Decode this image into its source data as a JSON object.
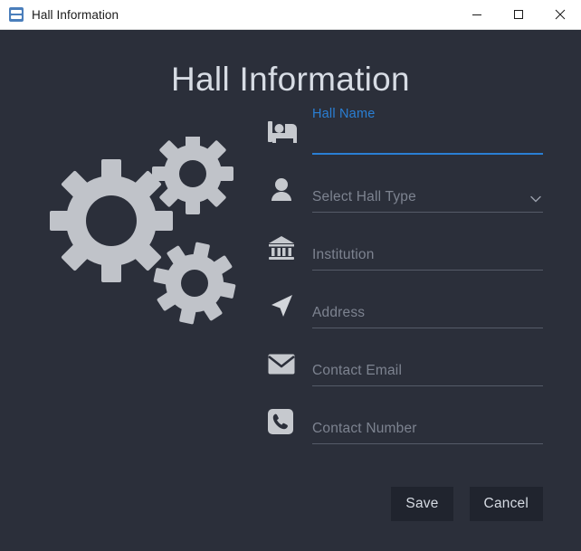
{
  "window": {
    "title": "Hall Information",
    "icon": "app-icon",
    "controls": {
      "minimize": "minimize-icon",
      "maximize": "maximize-icon",
      "close": "close-icon"
    },
    "colors": {
      "titlebar_bg": "#ffffff",
      "titlebar_text": "#1a1a1a",
      "body_bg": "#2b2f3a",
      "accent": "#2a7fd4",
      "placeholder": "#7d8390",
      "heading": "#d7dce4",
      "icon_gray": "#c6c9ce",
      "button_bg": "#20242e"
    }
  },
  "heading": "Hall Information",
  "illustration": {
    "name": "gears-illustration",
    "color": "#c0c3c9",
    "gear_count": 3
  },
  "form": {
    "fields": [
      {
        "name": "hall-name",
        "icon": "bed-icon",
        "float_label": "Hall Name",
        "value": "",
        "placeholder": "",
        "focused": true,
        "type": "text"
      },
      {
        "name": "hall-type",
        "icon": "person-icon",
        "float_label": "",
        "value": "",
        "placeholder": "Select Hall Type",
        "focused": false,
        "type": "select",
        "chevron": "chevron-down-icon"
      },
      {
        "name": "institution",
        "icon": "bank-icon",
        "float_label": "",
        "value": "",
        "placeholder": "Institution",
        "focused": false,
        "type": "text"
      },
      {
        "name": "address",
        "icon": "navigation-arrow-icon",
        "float_label": "",
        "value": "",
        "placeholder": "Address",
        "focused": false,
        "type": "text"
      },
      {
        "name": "contact-email",
        "icon": "envelope-icon",
        "float_label": "",
        "value": "",
        "placeholder": "Contact Email",
        "focused": false,
        "type": "email"
      },
      {
        "name": "contact-number",
        "icon": "phone-icon",
        "float_label": "",
        "value": "",
        "placeholder": "Contact Number",
        "focused": false,
        "type": "tel"
      }
    ]
  },
  "actions": {
    "save_label": "Save",
    "cancel_label": "Cancel"
  }
}
